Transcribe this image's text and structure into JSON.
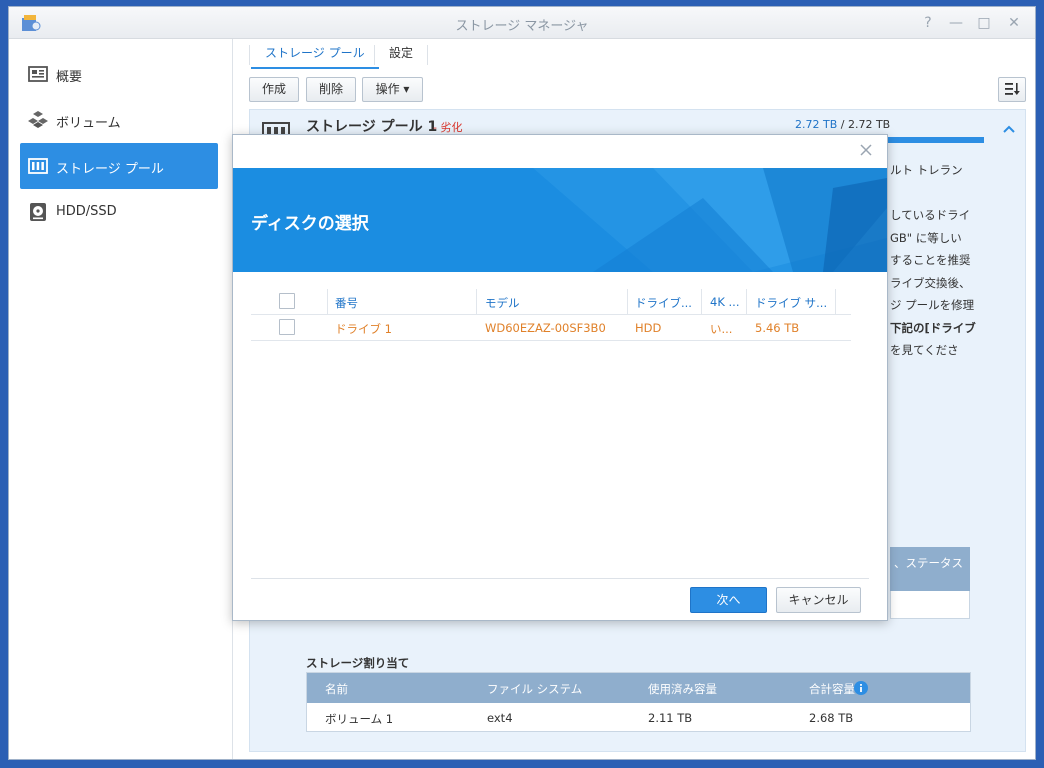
{
  "window": {
    "title": "ストレージ マネージャ",
    "controls": {
      "help": "?",
      "minimize": "—",
      "maximize": "□",
      "close": "✕"
    }
  },
  "sidebar": {
    "items": [
      {
        "label": "概要",
        "icon": "overview-icon"
      },
      {
        "label": "ボリューム",
        "icon": "volume-icon"
      },
      {
        "label": "ストレージ プール",
        "icon": "storage-pool-icon",
        "active": true
      },
      {
        "label": "HDD/SSD",
        "icon": "hdd-icon"
      }
    ]
  },
  "tabs": [
    {
      "label": "ストレージ プール",
      "active": true
    },
    {
      "label": "設定"
    }
  ],
  "toolbar": {
    "create": "作成",
    "delete": "削除",
    "action": "操作 ▾"
  },
  "pool": {
    "title": "ストレージ プール 1",
    "status": "- 劣化",
    "used": "2.72 TB",
    "separator": " / ",
    "total": "2.72 TB",
    "bg_lines": [
      "ルト トレラン",
      "しているドライ",
      "GB\" に等しい",
      "することを推奨",
      "ライブ交換後、",
      "ジ プールを修理",
      "下記の[ドライブ",
      "を見てくださ"
    ],
    "bg_status_header": "、ステータス"
  },
  "allocation": {
    "title": "ストレージ割り当て",
    "headers": {
      "name": "名前",
      "fs": "ファイル システム",
      "used": "使用済み容量",
      "total": "合計容量"
    },
    "row": {
      "name": "ボリューム 1",
      "fs": "ext4",
      "used": "2.11 TB",
      "total": "2.68 TB"
    }
  },
  "dialog": {
    "title": "ディスクの選択",
    "columns": {
      "number": "番号",
      "model": "モデル",
      "type": "ドライブ...",
      "fourk": "4K ...",
      "size": "ドライブ サ..."
    },
    "row": {
      "number": "ドライブ 1",
      "model": "WD60EZAZ-00SF3B0",
      "type": "HDD",
      "fourk": "い...",
      "size": "5.46 TB"
    },
    "next_label": "次へ",
    "cancel_label": "キャンセル"
  },
  "colors": {
    "accent": "#2d8ee3",
    "warning": "#d9342b",
    "row_highlight": "#e0812a",
    "table_header": "#8faecd"
  }
}
